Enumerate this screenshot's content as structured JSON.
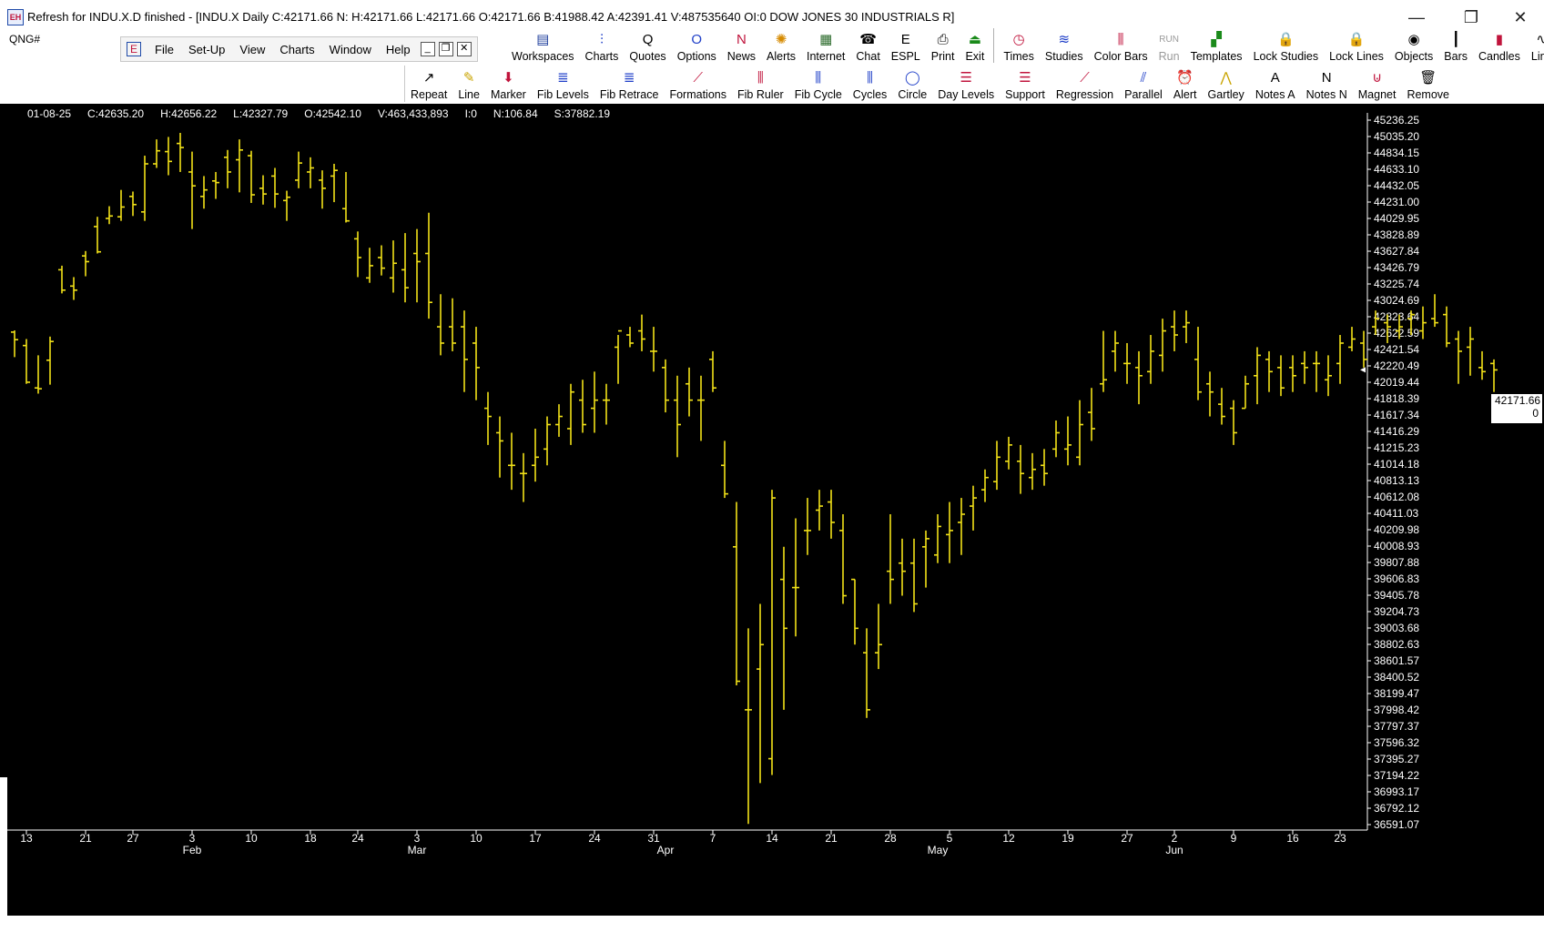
{
  "window": {
    "title": "Refresh for INDU.X.D finished - [INDU.X Daily C:42171.66 N: H:42171.66 L:42171.66 O:42171.66 B:41988.42 A:42391.41 V:487535640 OI:0 DOW JONES 30 INDUSTRIALS R]",
    "icon_text": "EH",
    "minimize": "—",
    "restore": "❐",
    "close": "✕"
  },
  "symbol_box": "QNG#",
  "menu": {
    "items": [
      "File",
      "Set-Up",
      "View",
      "Charts",
      "Window",
      "Help"
    ],
    "mdi": [
      "_",
      "❐",
      "✕"
    ]
  },
  "toolbar1": [
    {
      "label": "Workspaces",
      "icon": "workspaces-icon",
      "glyph": "▤",
      "color": "#1f3f9c"
    },
    {
      "label": "Charts",
      "icon": "charts-icon",
      "glyph": "⫶",
      "color": "#1f3fc8"
    },
    {
      "label": "Quotes",
      "icon": "quotes-icon",
      "glyph": "Q",
      "color": "#000000"
    },
    {
      "label": "Options",
      "icon": "options-icon",
      "glyph": "O",
      "color": "#1f3fc8"
    },
    {
      "label": "News",
      "icon": "news-icon",
      "glyph": "N",
      "color": "#c0143c"
    },
    {
      "label": "Alerts",
      "icon": "alerts-icon",
      "glyph": "✺",
      "color": "#d68a00"
    },
    {
      "label": "Internet",
      "icon": "internet-icon",
      "glyph": "▦",
      "color": "#2a6a2a"
    },
    {
      "label": "Chat",
      "icon": "chat-icon",
      "glyph": "☎",
      "color": "#000000"
    },
    {
      "label": "ESPL",
      "icon": "espl-icon",
      "glyph": "E",
      "color": "#000000"
    },
    {
      "label": "Print",
      "icon": "print-icon",
      "glyph": "⎙",
      "color": "#000000"
    },
    {
      "label": "Exit",
      "icon": "exit-icon",
      "glyph": "⏏",
      "color": "#1a8a1a"
    },
    {
      "label": "Times",
      "icon": "times-icon",
      "glyph": "◷",
      "color": "#c0143c"
    },
    {
      "label": "Studies",
      "icon": "studies-icon",
      "glyph": "≋",
      "color": "#1f3fc8"
    },
    {
      "label": "Color Bars",
      "icon": "color-bars-icon",
      "glyph": "⫼",
      "color": "#c0143c"
    },
    {
      "label": "Run",
      "icon": "run-icon",
      "glyph": "RUN",
      "color": "#9a9a9a",
      "disabled": true
    },
    {
      "label": "Templates",
      "icon": "templates-icon",
      "glyph": "▞",
      "color": "#1a8a1a"
    },
    {
      "label": "Lock Studies",
      "icon": "lock-studies-icon",
      "glyph": "🔒",
      "color": "#c9a400"
    },
    {
      "label": "Lock Lines",
      "icon": "lock-lines-icon",
      "glyph": "🔒",
      "color": "#c9a400"
    },
    {
      "label": "Objects",
      "icon": "objects-icon",
      "glyph": "◉",
      "color": "#000000"
    },
    {
      "label": "Bars",
      "icon": "bars-icon",
      "glyph": "┃",
      "color": "#000000"
    },
    {
      "label": "Candles",
      "icon": "candles-icon",
      "glyph": "▮",
      "color": "#c0143c"
    },
    {
      "label": "Line",
      "icon": "line-icon",
      "glyph": "∿",
      "color": "#000000"
    }
  ],
  "toolbar2": [
    {
      "label": "Repeat",
      "icon": "repeat-icon",
      "glyph": "↗",
      "color": "#000000"
    },
    {
      "label": "Line",
      "icon": "draw-line-icon",
      "glyph": "✎",
      "color": "#c9a400"
    },
    {
      "label": "Marker",
      "icon": "marker-icon",
      "glyph": "⬇",
      "color": "#c0143c"
    },
    {
      "label": "Fib Levels",
      "icon": "fib-levels-icon",
      "glyph": "≣",
      "color": "#1f3fc8"
    },
    {
      "label": "Fib Retrace",
      "icon": "fib-retrace-icon",
      "glyph": "≣",
      "color": "#1f3fc8"
    },
    {
      "label": "Formations",
      "icon": "formations-icon",
      "glyph": "⟋",
      "color": "#c0143c"
    },
    {
      "label": "Fib Ruler",
      "icon": "fib-ruler-icon",
      "glyph": "⫼",
      "color": "#c0143c"
    },
    {
      "label": "Fib Cycle",
      "icon": "fib-cycle-icon",
      "glyph": "⫼",
      "color": "#1f3fc8"
    },
    {
      "label": "Cycles",
      "icon": "cycles-icon",
      "glyph": "⫼",
      "color": "#1f3fc8"
    },
    {
      "label": "Circle",
      "icon": "circle-icon",
      "glyph": "◯",
      "color": "#1f3fc8"
    },
    {
      "label": "Day Levels",
      "icon": "day-levels-icon",
      "glyph": "☰",
      "color": "#c0143c"
    },
    {
      "label": "Support",
      "icon": "support-icon",
      "glyph": "☰",
      "color": "#c0143c"
    },
    {
      "label": "Regression",
      "icon": "regression-icon",
      "glyph": "⟋",
      "color": "#c0143c"
    },
    {
      "label": "Parallel",
      "icon": "parallel-icon",
      "glyph": "⫽",
      "color": "#1f3fc8"
    },
    {
      "label": "Alert",
      "icon": "alarm-clock-icon",
      "glyph": "⏰",
      "color": "#c0143c"
    },
    {
      "label": "Gartley",
      "icon": "gartley-icon",
      "glyph": "⋀",
      "color": "#c9a400"
    },
    {
      "label": "Notes  A",
      "icon": "notes-a-icon",
      "glyph": "A",
      "color": "#000000"
    },
    {
      "label": "Notes  N",
      "icon": "notes-n-icon",
      "glyph": "N",
      "color": "#000000"
    },
    {
      "label": "Magnet",
      "icon": "magnet-icon",
      "glyph": "⊍",
      "color": "#c0143c"
    },
    {
      "label": "Remove",
      "icon": "trash-icon",
      "glyph": "🗑",
      "color": "#000000"
    }
  ],
  "info_bar": {
    "date": "01-08-25",
    "close": "C:42635.20",
    "high": "H:42656.22",
    "low": "L:42327.79",
    "open": "O:42542.10",
    "volume": "V:463,433,893",
    "interest": "I:0",
    "net": "N:106.84",
    "s": "S:37882.19"
  },
  "last_price": {
    "value": "42171.66",
    "sub": "0"
  },
  "colors": {
    "background": "#000000",
    "bars": "#f2e218",
    "axis_text": "#ffffff",
    "price_tag": "#ffffff"
  },
  "chart_data": {
    "type": "bar",
    "subtype": "ohlc",
    "title": "INDU.X Daily",
    "bar_color": "#f2e218",
    "ylim": [
      36591.07,
      45236.25
    ],
    "y_ticks": [
      "45236.25",
      "45035.20",
      "44834.15",
      "44633.10",
      "44432.05",
      "44231.00",
      "44029.95",
      "43828.89",
      "43627.84",
      "43426.79",
      "43225.74",
      "43024.69",
      "42823.64",
      "42622.59",
      "42421.54",
      "42220.49",
      "42019.44",
      "41818.39",
      "41617.34",
      "41416.29",
      "41215.23",
      "41014.18",
      "40813.13",
      "40612.08",
      "40411.03",
      "40209.98",
      "40008.93",
      "39807.88",
      "39606.83",
      "39405.78",
      "39204.73",
      "39003.68",
      "38802.63",
      "38601.57",
      "38400.52",
      "38199.47",
      "37998.42",
      "37797.37",
      "37596.32",
      "37395.27",
      "37194.22",
      "36993.17",
      "36792.12",
      "36591.07"
    ],
    "x_ticks": [
      {
        "label": "13",
        "bar": 1
      },
      {
        "label": "21",
        "bar": 6
      },
      {
        "label": "27",
        "bar": 10
      },
      {
        "label": "3",
        "bar": 15
      },
      {
        "label": "10",
        "bar": 20
      },
      {
        "label": "18",
        "bar": 25
      },
      {
        "label": "24",
        "bar": 29
      },
      {
        "label": "3",
        "bar": 34
      },
      {
        "label": "10",
        "bar": 39
      },
      {
        "label": "17",
        "bar": 44
      },
      {
        "label": "24",
        "bar": 49
      },
      {
        "label": "31",
        "bar": 54
      },
      {
        "label": "7",
        "bar": 59
      },
      {
        "label": "14",
        "bar": 64
      },
      {
        "label": "21",
        "bar": 69
      },
      {
        "label": "28",
        "bar": 74
      },
      {
        "label": "5",
        "bar": 79
      },
      {
        "label": "12",
        "bar": 84
      },
      {
        "label": "19",
        "bar": 89
      },
      {
        "label": "27",
        "bar": 94
      },
      {
        "label": "2",
        "bar": 98
      },
      {
        "label": "9",
        "bar": 103
      },
      {
        "label": "16",
        "bar": 108
      },
      {
        "label": "23",
        "bar": 112
      }
    ],
    "months": [
      {
        "label": "Feb",
        "bar": 15
      },
      {
        "label": "Mar",
        "bar": 34
      },
      {
        "label": "Apr",
        "bar": 55
      },
      {
        "label": "May",
        "bar": 78
      },
      {
        "label": "Jun",
        "bar": 98
      }
    ],
    "bars": [
      [
        42635,
        42656,
        42328,
        42542
      ],
      [
        42470,
        42550,
        42000,
        42020
      ],
      [
        41950,
        42350,
        41880,
        41940
      ],
      [
        42290,
        42580,
        41990,
        42520
      ],
      [
        43400,
        43450,
        43110,
        43150
      ],
      [
        43200,
        43310,
        43030,
        43150
      ],
      [
        43570,
        43630,
        43320,
        43500
      ],
      [
        43930,
        44050,
        43600,
        43620
      ],
      [
        44030,
        44180,
        43960,
        44060
      ],
      [
        44050,
        44380,
        44000,
        44170
      ],
      [
        44300,
        44360,
        44060,
        44200
      ],
      [
        44110,
        44800,
        44000,
        44700
      ],
      [
        44700,
        45000,
        44650,
        44860
      ],
      [
        44850,
        45030,
        44560,
        44730
      ],
      [
        44950,
        45080,
        44600,
        44900
      ],
      [
        44600,
        44850,
        43900,
        44430
      ],
      [
        44300,
        44550,
        44150,
        44380
      ],
      [
        44490,
        44600,
        44270,
        44470
      ],
      [
        44780,
        44870,
        44400,
        44600
      ],
      [
        44750,
        45000,
        44350,
        44870
      ],
      [
        44800,
        44860,
        44220,
        44320
      ],
      [
        44400,
        44560,
        44200,
        44330
      ],
      [
        44550,
        44650,
        44160,
        44330
      ],
      [
        44250,
        44370,
        44000,
        44290
      ],
      [
        44500,
        44850,
        44400,
        44710
      ],
      [
        44600,
        44780,
        44400,
        44650
      ],
      [
        44500,
        44620,
        44150,
        44400
      ],
      [
        44550,
        44700,
        44230,
        44620
      ],
      [
        44150,
        44600,
        43980,
        44000
      ],
      [
        43780,
        43870,
        43310,
        43550
      ],
      [
        43300,
        43670,
        43240,
        43450
      ],
      [
        43550,
        43700,
        43330,
        43420
      ],
      [
        43300,
        43760,
        43120,
        43480
      ],
      [
        43400,
        43850,
        43000,
        43180
      ],
      [
        43600,
        43900,
        43000,
        43500
      ],
      [
        43600,
        44100,
        42800,
        43000
      ],
      [
        42700,
        43100,
        42350,
        42500
      ],
      [
        42700,
        43050,
        42400,
        42500
      ],
      [
        42700,
        42900,
        41900,
        42300
      ],
      [
        42500,
        42700,
        41800,
        42200
      ],
      [
        41700,
        41900,
        41250,
        41600
      ],
      [
        41400,
        41600,
        40850,
        41300
      ],
      [
        41000,
        41400,
        40700,
        41000
      ],
      [
        40900,
        41150,
        40550,
        40900
      ],
      [
        41000,
        41450,
        40800,
        41100
      ],
      [
        41200,
        41600,
        41000,
        41500
      ],
      [
        41500,
        41750,
        41350,
        41600
      ],
      [
        41450,
        42000,
        41250,
        41900
      ],
      [
        41800,
        42050,
        41400,
        41500
      ],
      [
        41700,
        42150,
        41400,
        41800
      ],
      [
        41800,
        42000,
        41500,
        41800
      ],
      [
        42450,
        42600,
        42000,
        42650
      ],
      [
        42600,
        42700,
        42450,
        42500
      ],
      [
        42650,
        42850,
        42400,
        42550
      ],
      [
        42400,
        42700,
        42150,
        42400
      ],
      [
        42200,
        42300,
        41650,
        41800
      ],
      [
        41800,
        42100,
        41100,
        41500
      ],
      [
        42000,
        42200,
        41600,
        41800
      ],
      [
        41800,
        42100,
        41300,
        41800
      ],
      [
        42300,
        42400,
        41900,
        41950
      ],
      [
        41000,
        41300,
        40600,
        40650
      ],
      [
        40000,
        40550,
        38300,
        38350
      ],
      [
        38000,
        39000,
        36600,
        38000
      ],
      [
        38500,
        39300,
        37100,
        38800
      ],
      [
        37400,
        40700,
        37200,
        40600
      ],
      [
        39600,
        40000,
        38000,
        39000
      ],
      [
        39500,
        40350,
        38900,
        39500
      ],
      [
        40200,
        40600,
        39900,
        40200
      ],
      [
        40450,
        40700,
        40200,
        40500
      ],
      [
        40550,
        40700,
        40100,
        40300
      ],
      [
        40200,
        40400,
        39300,
        39400
      ],
      [
        39600,
        39600,
        38800,
        39000
      ],
      [
        38700,
        39000,
        37900,
        38000
      ],
      [
        38700,
        39300,
        38500,
        38800
      ],
      [
        39700,
        40400,
        39300,
        39600
      ],
      [
        39800,
        40100,
        39400,
        39700
      ],
      [
        39800,
        40100,
        39200,
        39300
      ],
      [
        40000,
        40200,
        39500,
        40100
      ],
      [
        39900,
        40400,
        39800,
        40250
      ],
      [
        40150,
        40550,
        39800,
        40200
      ],
      [
        40300,
        40600,
        39900,
        40400
      ],
      [
        40500,
        40750,
        40200,
        40600
      ],
      [
        40700,
        40950,
        40550,
        40850
      ],
      [
        40800,
        41300,
        40700,
        41100
      ],
      [
        41050,
        41350,
        40950,
        41250
      ],
      [
        41050,
        41250,
        40650,
        40900
      ],
      [
        40850,
        41150,
        40700,
        40950
      ],
      [
        41000,
        41200,
        40750,
        40900
      ],
      [
        41200,
        41550,
        41100,
        41400
      ],
      [
        41200,
        41600,
        41000,
        41250
      ],
      [
        41100,
        41800,
        41000,
        41500
      ],
      [
        41650,
        41950,
        41300,
        41450
      ],
      [
        42000,
        42650,
        41900,
        42050
      ],
      [
        42400,
        42650,
        42150,
        42500
      ],
      [
        42250,
        42500,
        42000,
        42250
      ],
      [
        42200,
        42400,
        41750,
        42100
      ],
      [
        42150,
        42600,
        42000,
        42400
      ],
      [
        42350,
        42800,
        42150,
        42650
      ],
      [
        42700,
        42900,
        42400,
        42600
      ],
      [
        42700,
        42900,
        42500,
        42750
      ],
      [
        42300,
        42700,
        41800,
        41900
      ],
      [
        42000,
        42150,
        41600,
        41900
      ],
      [
        41750,
        41950,
        41500,
        41600
      ],
      [
        41700,
        41800,
        41250,
        41400
      ],
      [
        41700,
        42100,
        41700,
        42000
      ],
      [
        42100,
        42450,
        41750,
        42350
      ],
      [
        42300,
        42400,
        41900,
        42150
      ],
      [
        42200,
        42350,
        41850,
        41950
      ],
      [
        42200,
        42350,
        41900,
        42100
      ],
      [
        42250,
        42400,
        42000,
        42200
      ],
      [
        42250,
        42400,
        41900,
        42250
      ],
      [
        42050,
        42350,
        41850,
        42100
      ],
      [
        42250,
        42600,
        42000,
        42500
      ],
      [
        42450,
        42700,
        42400,
        42550
      ],
      [
        42500,
        42650,
        42200,
        42300
      ],
      [
        42700,
        42900,
        42600,
        42800
      ],
      [
        42750,
        42850,
        42500,
        42700
      ],
      [
        42650,
        42850,
        42550,
        42700
      ],
      [
        42800,
        42900,
        42600,
        42850
      ],
      [
        42650,
        42950,
        42550,
        42750
      ],
      [
        42800,
        43100,
        42700,
        42750
      ],
      [
        42850,
        42950,
        42450,
        42500
      ],
      [
        42550,
        42650,
        42000,
        42400
      ],
      [
        42450,
        42700,
        42100,
        42550
      ],
      [
        42200,
        42400,
        42050,
        42150
      ],
      [
        42250,
        42300,
        41900,
        42171
      ]
    ]
  }
}
